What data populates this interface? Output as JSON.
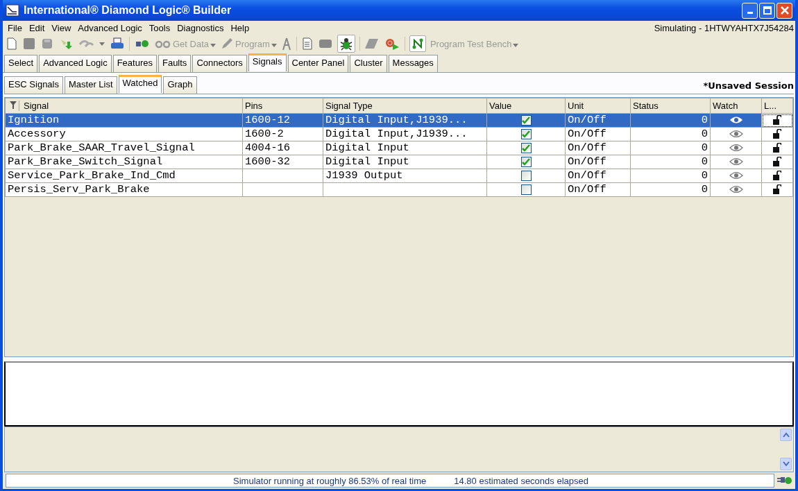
{
  "window": {
    "title": "International® Diamond Logic® Builder"
  },
  "menu": [
    "File",
    "Edit",
    "View",
    "Advanced Logic",
    "Tools",
    "Diagnostics",
    "Help"
  ],
  "sim_status": "Simulating - 1HTWYAHTX7J54284",
  "toolbar": {
    "get_data": "Get Data",
    "program": "Program",
    "test_bench": "Program Test Bench"
  },
  "tabs": [
    {
      "label": "Select",
      "selected": false
    },
    {
      "label": "Advanced Logic",
      "selected": false
    },
    {
      "label": "Features",
      "selected": false
    },
    {
      "label": "Faults",
      "selected": false
    },
    {
      "label": "Connectors",
      "selected": false
    },
    {
      "label": "Signals",
      "selected": true
    },
    {
      "label": "Center Panel",
      "selected": false
    },
    {
      "label": "Cluster",
      "selected": false
    },
    {
      "label": "Messages",
      "selected": false
    }
  ],
  "subtabs": [
    {
      "label": "ESC Signals",
      "selected": false
    },
    {
      "label": "Master List",
      "selected": false
    },
    {
      "label": "Watched",
      "selected": true
    },
    {
      "label": "Graph",
      "selected": false
    }
  ],
  "session": "*Unsaved Session",
  "table": {
    "columns": [
      "Signal",
      "Pins",
      "Signal Type",
      "Value",
      "Unit",
      "Status",
      "Watch",
      "L..."
    ],
    "rows": [
      {
        "signal": "Ignition",
        "pins": "1600-12",
        "type": "Digital Input,J1939...",
        "checked": true,
        "unit": "On/Off",
        "status": "0",
        "selected": true
      },
      {
        "signal": "Accessory",
        "pins": "1600-2",
        "type": "Digital Input,J1939...",
        "checked": true,
        "unit": "On/Off",
        "status": "0",
        "selected": false
      },
      {
        "signal": "Park_Brake_SAAR_Travel_Signal",
        "pins": "4004-16",
        "type": "Digital Input",
        "checked": true,
        "unit": "On/Off",
        "status": "0",
        "selected": false
      },
      {
        "signal": "Park_Brake_Switch_Signal",
        "pins": "1600-32",
        "type": "Digital Input",
        "checked": true,
        "unit": "On/Off",
        "status": "0",
        "selected": false
      },
      {
        "signal": "Service_Park_Brake_Ind_Cmd",
        "type": "J1939 Output",
        "checked": false,
        "unit": "On/Off",
        "status": "0",
        "selected": false
      },
      {
        "signal": "Persis_Serv_Park_Brake",
        "checked": false,
        "unit": "On/Off",
        "status": "0",
        "selected": false
      }
    ]
  },
  "status_bar": [
    "Simulator running at roughly 86.53% of real time",
    "14.80 estimated seconds elapsed"
  ]
}
